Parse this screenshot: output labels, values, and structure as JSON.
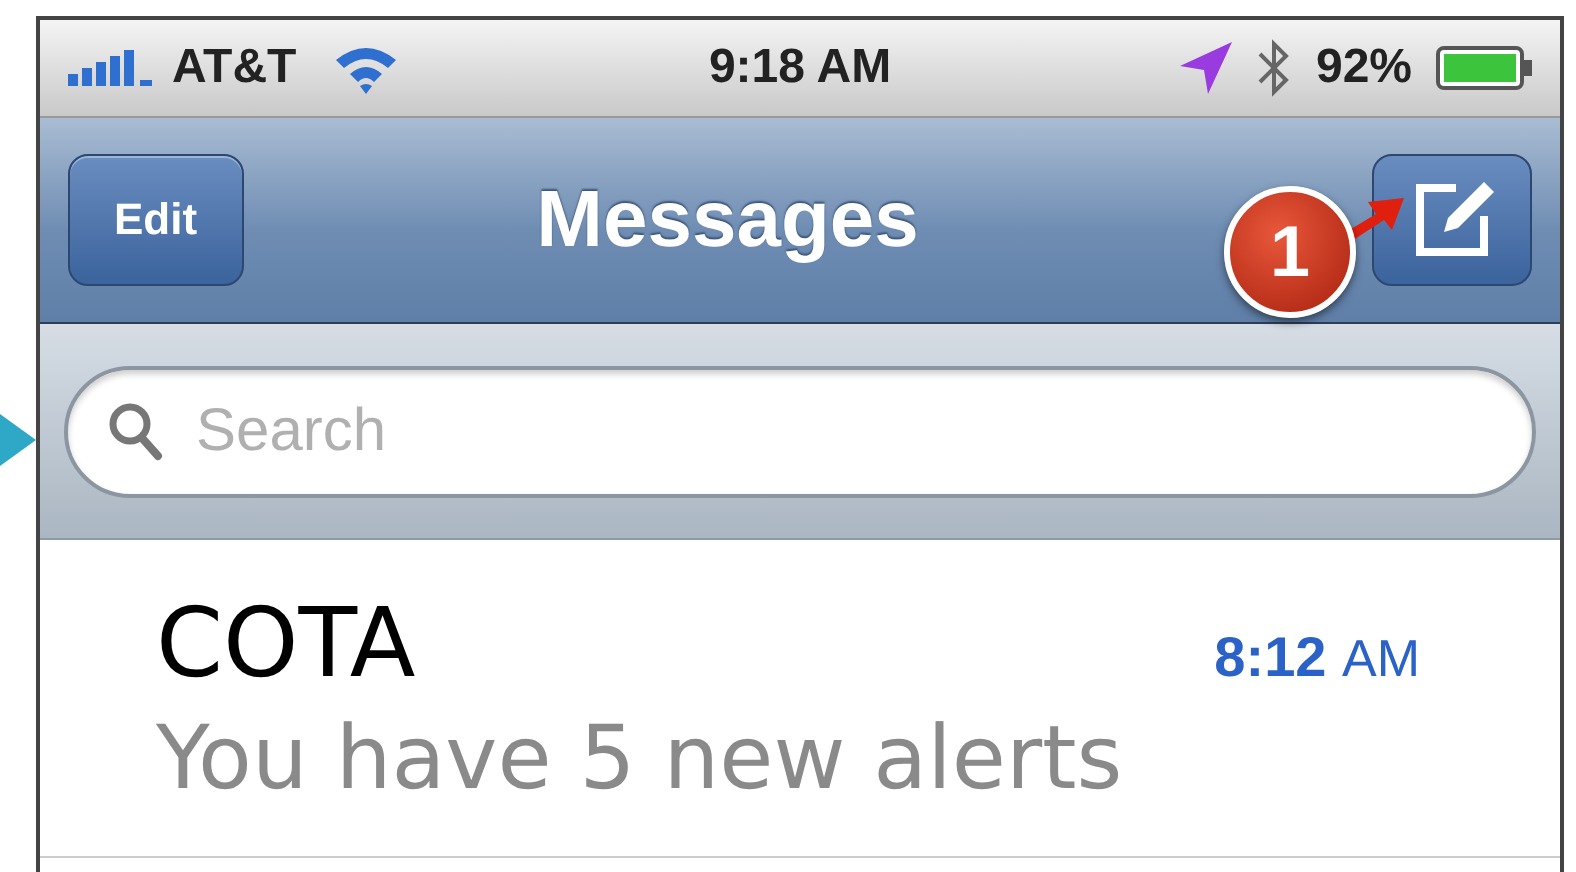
{
  "status_bar": {
    "carrier": "AT&T",
    "time": "9:18 AM",
    "battery": "92%"
  },
  "nav_bar": {
    "left_button": "Edit",
    "title": "Messages"
  },
  "callout": {
    "number": "1"
  },
  "search": {
    "placeholder": "Search"
  },
  "conversations": [
    {
      "name": "COTA",
      "time": "8:12",
      "meridiem": "AM",
      "preview": "You have 5 new alerts"
    }
  ]
}
